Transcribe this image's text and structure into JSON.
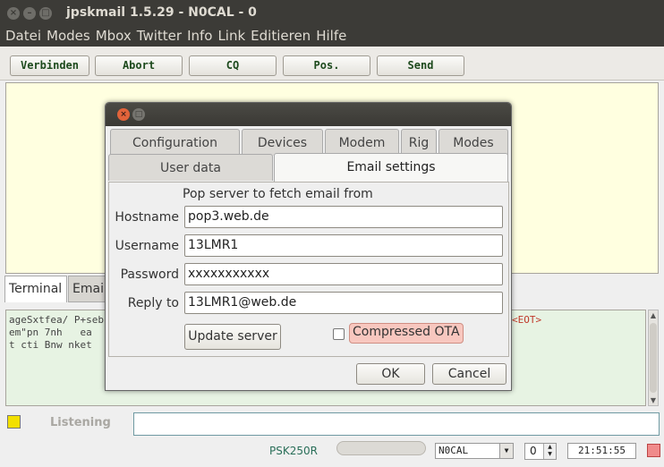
{
  "window": {
    "title": "jpskmail 1.5.29 - N0CAL - 0"
  },
  "menu": [
    "Datei",
    "Modes",
    "Mbox",
    "Twitter",
    "Info",
    "Link",
    "Editieren",
    "Hilfe"
  ],
  "toolbar": {
    "connect": "Verbinden",
    "abort": "Abort",
    "cq": "CQ",
    "pos": "Pos.",
    "send": "Send"
  },
  "main_tabs": {
    "terminal": "Terminal",
    "email": "Email"
  },
  "terminal": {
    "lines": [
      "ageSxtfea/ P+seb",
      "em\"pn 7nh   ea ",
      "t cti Bnw nket "
    ],
    "eot": "<EOT>"
  },
  "status": {
    "listening": "Listening",
    "mode": "PSK250R",
    "callsign": "N0CAL",
    "spinner": "0",
    "clock": "21:51:55",
    "led_color": "#f3e000",
    "tx_led_color": "#f08b8b"
  },
  "dialog": {
    "tabs_row1": [
      "Configuration",
      "Devices",
      "Modem",
      "Rig",
      "Modes"
    ],
    "tabs_row2": [
      "User data",
      "Email settings"
    ],
    "active_tab": "Email settings",
    "pop_label": "Pop server to fetch email from",
    "hostname_label": "Hostname",
    "hostname": "pop3.web.de",
    "username_label": "Username",
    "username": "13LMR1",
    "password_label": "Password",
    "password": "xxxxxxxxxxx",
    "replyto_label": "Reply to",
    "replyto": "13LMR1@web.de",
    "update_button": "Update server",
    "compressed_label": "Compressed OTA",
    "compressed_checked": false,
    "ok": "OK",
    "cancel": "Cancel"
  }
}
